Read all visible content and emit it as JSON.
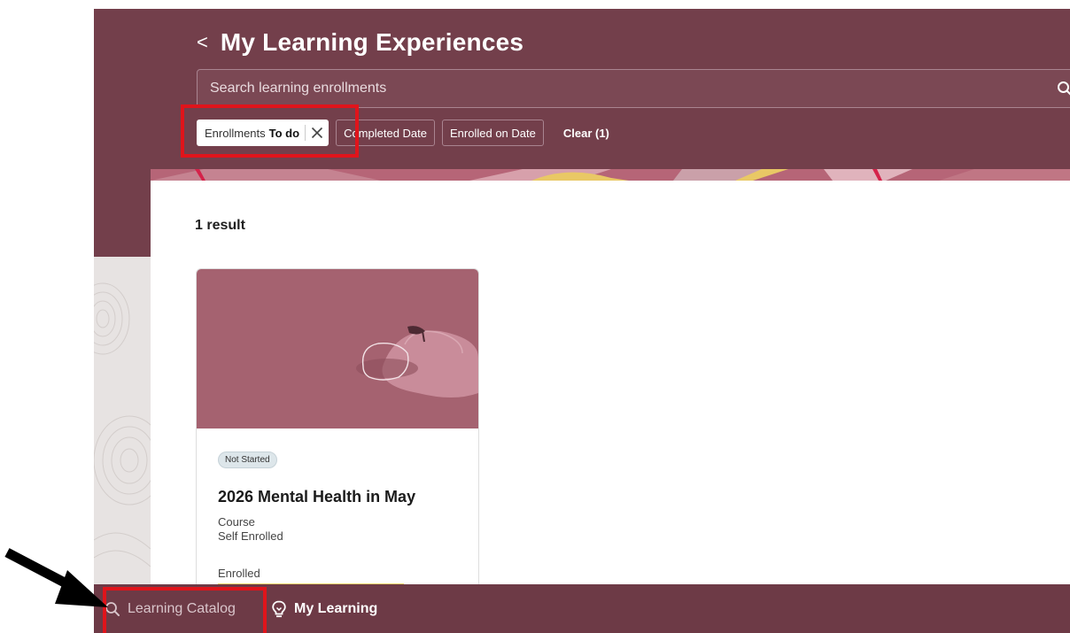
{
  "header": {
    "back_symbol": "<",
    "title": "My Learning Experiences"
  },
  "search": {
    "placeholder": "Search learning enrollments"
  },
  "filters": {
    "active_chip": {
      "label": "Enrollments",
      "value": "To do"
    },
    "chips": [
      "Completed Date",
      "Enrolled on Date"
    ],
    "clear_label": "Clear (1)"
  },
  "results": {
    "count_label": "1 result"
  },
  "card": {
    "status": "Not Started",
    "title": "2026 Mental Health in May",
    "type": "Course",
    "enrollment_type": "Self Enrolled",
    "enrolled_label": "Enrolled"
  },
  "bottom_nav": {
    "catalog_label": "Learning Catalog",
    "my_learning_label": "My Learning"
  },
  "colors": {
    "header_bg": "#733f4b",
    "card_image_bg": "#a56270",
    "nav_bg": "#6d3a46",
    "highlight": "#e0141b"
  },
  "icons": {
    "search": "search-icon",
    "close": "close-icon",
    "lightbulb": "lightbulb-icon"
  }
}
